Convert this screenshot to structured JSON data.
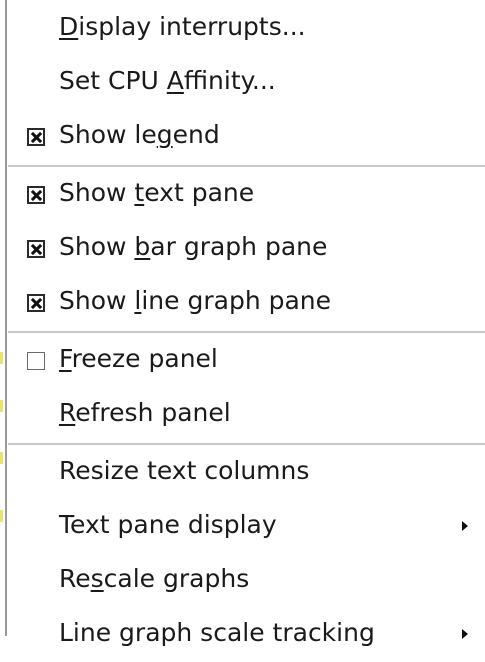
{
  "menu": {
    "groups": [
      {
        "items": [
          {
            "pre": "",
            "mnemonic": "D",
            "post": "isplay interrupts...",
            "check": "none",
            "submenu": false
          },
          {
            "pre": "Set CPU ",
            "mnemonic": "A",
            "post": "ffinity...",
            "check": "none",
            "submenu": false
          },
          {
            "pre": "Show le",
            "mnemonic": "g",
            "post": "end",
            "check": "checked",
            "submenu": false
          }
        ]
      },
      {
        "items": [
          {
            "pre": "Show ",
            "mnemonic": "t",
            "post": "ext pane",
            "check": "checked",
            "submenu": false
          },
          {
            "pre": "Show ",
            "mnemonic": "b",
            "post": "ar graph pane",
            "check": "checked",
            "submenu": false
          },
          {
            "pre": "Show ",
            "mnemonic": "l",
            "post": "ine graph pane",
            "check": "checked",
            "submenu": false
          }
        ]
      },
      {
        "items": [
          {
            "pre": "",
            "mnemonic": "F",
            "post": "reeze panel",
            "check": "unchecked",
            "submenu": false
          },
          {
            "pre": "",
            "mnemonic": "R",
            "post": "efresh panel",
            "check": "none",
            "submenu": false
          }
        ]
      },
      {
        "items": [
          {
            "pre": "Resize text columns",
            "mnemonic": "",
            "post": "",
            "check": "none",
            "submenu": false
          },
          {
            "pre": "Text pane display",
            "mnemonic": "",
            "post": "",
            "check": "none",
            "submenu": true
          },
          {
            "pre": "Re",
            "mnemonic": "s",
            "post": "cale graphs",
            "check": "none",
            "submenu": false
          },
          {
            "pre": "Line graph scale tracking",
            "mnemonic": "",
            "post": "",
            "check": "none",
            "submenu": true
          }
        ]
      }
    ]
  },
  "icons": {
    "checkbox_checked": "checkbox-checked-icon",
    "checkbox_unchecked": "checkbox-unchecked-icon",
    "submenu_arrow": "submenu-arrow-icon"
  },
  "colors": {
    "menu_background": "#ffffff",
    "text": "#1a1a1a",
    "separator": "#c8c8c4",
    "window_edge": "#9a9a96"
  }
}
